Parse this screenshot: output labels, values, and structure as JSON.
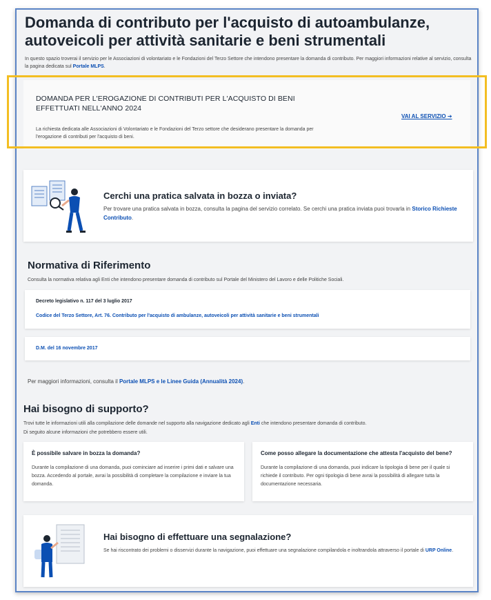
{
  "header": {
    "title": "Domanda di contributo per l'acquisto di autoambulanze, autoveicoli per attività sanitarie e beni strumentali",
    "intro_text": "In questo spazio troverai il servizio per le Associazioni di volontariato e le Fondazioni del Terzo Settore che intendono presentare la domanda di contributo. Per maggiori informazioni relative al servizio, consulta la pagina dedicata sul ",
    "intro_link": "Portale MLPS",
    "intro_end": "."
  },
  "service": {
    "title": "DOMANDA PER L'EROGAZIONE DI CONTRIBUTI PER L'ACQUISTO DI BENI EFFETTUATI NELL'ANNO 2024",
    "description": "La richiesta dedicata alle Associazioni di Volontariato e le Fondazioni del Terzo settore che desiderano presentare la domanda per l'erogazione di contributi per l'acquisto di beni.",
    "link_label": "VAI AL SERVIZIO ➔"
  },
  "draft": {
    "title": "Cerchi una pratica salvata in bozza o inviata?",
    "text": "Per trovare una pratica salvata in bozza, consulta la pagina del servizio correlato. Se cerchi una pratica inviata puoi trovarla in ",
    "link": "Storico Richieste Contributo",
    "end": "."
  },
  "normativa": {
    "title": "Normativa di Riferimento",
    "subtitle": "Consulta la normativa relativa agli Enti che intendono presentare domanda di contributo sul Portale del Ministero del Lavoro e delle Politiche Sociali.",
    "decree_head": "Decreto legislativo n. 117 del 3 luglio 2017",
    "decree_link": "Codice del Terzo Settore, Art. 76. Contributo per l'acquisto di ambulanze, autoveicoli per attività sanitarie e beni strumentali",
    "dm_link": "D.M. del 16 novembre 2017",
    "more_info_prefix": "Per maggiori informazioni, consulta il ",
    "more_info_link": "Portale MLPS e le Linee Guida (Annualità 2024)",
    "more_info_end": "."
  },
  "support": {
    "title": "Hai bisogno di supporto?",
    "line1_prefix": "Trovi tutte le informazioni utili alla compilazione delle domande nel supporto alla navigazione dedicato agli ",
    "line1_link": "Enti",
    "line1_end": " che intendono presentare domanda di contributo.",
    "line2": "Di seguito alcune informazioni che potrebbero essere utili.",
    "faq": [
      {
        "question": "È possibile salvare in bozza la domanda?",
        "answer": "Durante la compilazione di una domanda, puoi cominciare ad inserire i primi dati e salvare una bozza. Accedendo al portale, avrai la possibilità di completare la compilazione e inviare la tua domanda."
      },
      {
        "question": "Come posso allegare la documentazione che attesta l'acquisto del bene?",
        "answer": "Durante la compilazione di una domanda, puoi indicare la tipologia di bene per il quale si richiede il contributo. Per ogni tipologia di bene avrai la possibilità di allegare tutta la documentazione necessaria."
      }
    ]
  },
  "report": {
    "title": "Hai bisogno di effettuare una segnalazione?",
    "text": "Se hai riscontrato dei problemi o disservizi durante la navigazione, puoi effettuare una segnalazione compilandola e inoltrandola attraverso il portale di ",
    "link": "URP Online",
    "end": "."
  },
  "colors": {
    "accent": "#0b4fb3",
    "highlight": "#f3be22",
    "frame": "#5a84c6"
  }
}
